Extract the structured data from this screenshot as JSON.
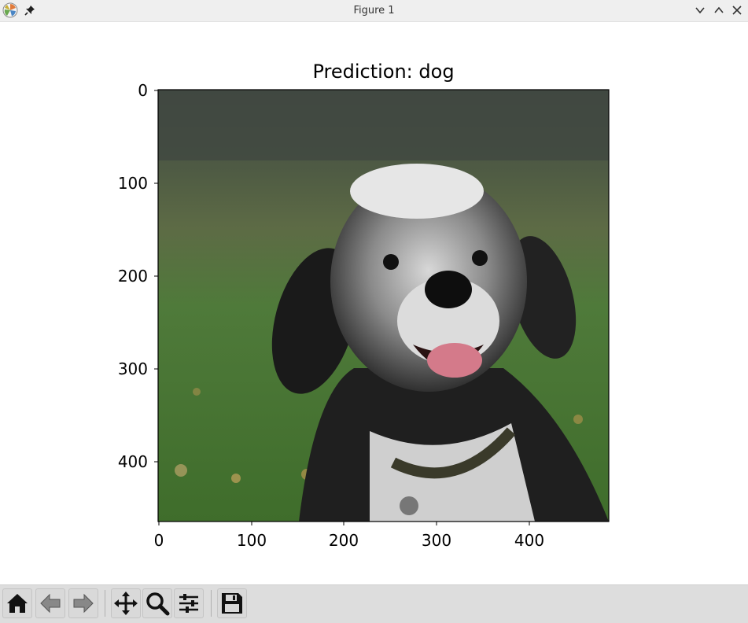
{
  "window": {
    "title": "Figure 1",
    "icons": [
      "matplotlib-logo-icon",
      "pin-icon",
      "minimize-icon",
      "maximize-icon",
      "close-icon"
    ]
  },
  "plot": {
    "title": "Prediction: dog",
    "x_ticks": [
      "0",
      "100",
      "200",
      "300",
      "400"
    ],
    "y_ticks": [
      "0",
      "100",
      "200",
      "300",
      "400"
    ],
    "image_subject": "dog"
  },
  "toolbar": {
    "buttons": [
      "home-icon",
      "back-icon",
      "forward-icon",
      "pan-icon",
      "zoom-icon",
      "configure-subplots-icon",
      "save-icon"
    ]
  }
}
